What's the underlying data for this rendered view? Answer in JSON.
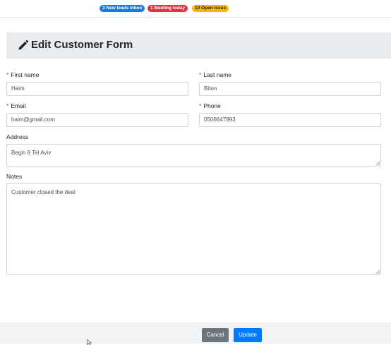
{
  "notifications": {
    "leads": "3 New leads inbox",
    "meetings": "1 Meeting today",
    "issues": "10 Open issus"
  },
  "form": {
    "title": "Edit Customer Form",
    "required_mark": "*",
    "first_name": {
      "label": "First name",
      "value": "Haim"
    },
    "last_name": {
      "label": "Last name",
      "value": "Biton"
    },
    "email": {
      "label": "Email",
      "value": "haim@gmail.com"
    },
    "phone": {
      "label": "Phone",
      "value": "0506647893"
    },
    "address": {
      "label": "Address",
      "value": "Begin 8 Tel Aviv"
    },
    "notes": {
      "label": "Notes",
      "value": "Customer closed the deal"
    }
  },
  "actions": {
    "cancel_label": "Cancel",
    "update_label": "Update"
  },
  "colors": {
    "primary": "#007bff",
    "secondary": "#6c757d",
    "danger": "#dc3545",
    "warning": "#f5b800",
    "info": "#1e7bd9",
    "header_bg": "#e9ecef"
  },
  "icons": {
    "header": "pencil-icon",
    "cursor": "mouse-cursor-icon"
  }
}
